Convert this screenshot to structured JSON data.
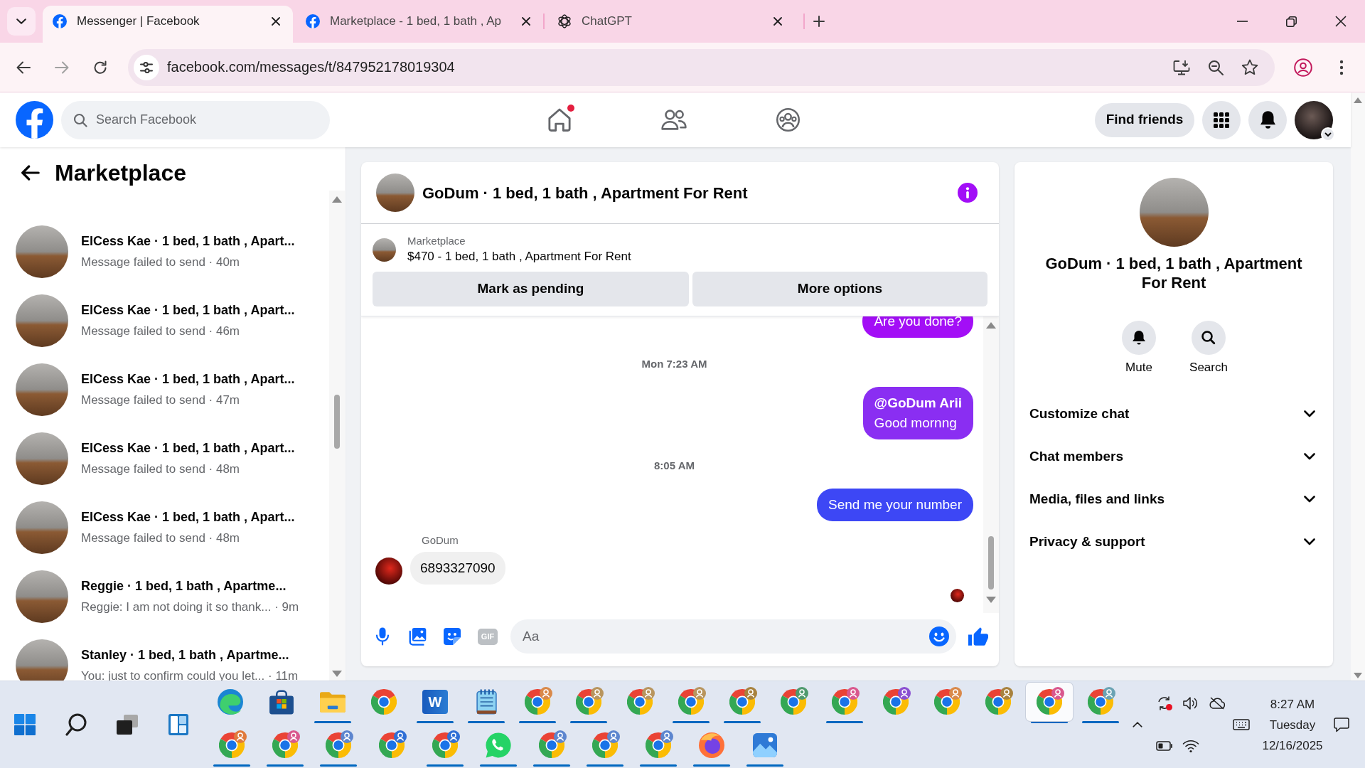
{
  "browser": {
    "tabs": [
      {
        "kind": "facebook",
        "title": "Messenger | Facebook",
        "selected": true
      },
      {
        "kind": "facebook",
        "title": "Marketplace - 1 bed, 1 bath , Ap",
        "selected": false
      },
      {
        "kind": "chatgpt",
        "title": "ChatGPT",
        "selected": false
      }
    ],
    "url": "facebook.com/messages/t/847952178019304"
  },
  "header": {
    "search": {
      "placeholder": "Search Facebook"
    },
    "nav": [
      {
        "kind": "home",
        "selected": false,
        "notification_dot": true
      },
      {
        "kind": "friends",
        "selected": false,
        "notification_dot": false
      },
      {
        "kind": "groups",
        "selected": false,
        "notification_dot": false
      }
    ],
    "find_friends": "Find friends"
  },
  "sidebar": {
    "title": "Marketplace",
    "conversations": [
      {
        "title": "ElCess Kae · 1 bed, 1 bath , Apart...",
        "subtitle": "Message failed to send · 40m"
      },
      {
        "title": "ElCess Kae · 1 bed, 1 bath , Apart...",
        "subtitle": "Message failed to send · 46m"
      },
      {
        "title": "ElCess Kae · 1 bed, 1 bath , Apart...",
        "subtitle": "Message failed to send · 47m"
      },
      {
        "title": "ElCess Kae · 1 bed, 1 bath , Apart...",
        "subtitle": "Message failed to send · 48m"
      },
      {
        "title": "ElCess Kae · 1 bed, 1 bath , Apart...",
        "subtitle": "Message failed to send · 48m"
      },
      {
        "title": "Reggie · 1 bed, 1 bath , Apartme...",
        "subtitle": "Reggie: I am not doing it so thank... · 9m"
      },
      {
        "title": "Stanley · 1 bed, 1 bath , Apartme...",
        "subtitle": "You: just to confirm could you let... · 11m"
      }
    ]
  },
  "chat": {
    "title": "GoDum · 1 bed, 1 bath , Apartment For Rent",
    "listing": {
      "source": "Marketplace",
      "text": "$470 - 1 bed, 1 bath , Apartment For Rent"
    },
    "actions": [
      "Mark as pending",
      "More options"
    ],
    "messages": [
      {
        "kind": "sent",
        "text": "Are you done?",
        "color": "#a30ef6"
      },
      {
        "kind": "timestamp",
        "text": "Mon 7:23 AM"
      },
      {
        "kind": "sent",
        "text": "**@GoDum Arii**\nGood mornng",
        "color": "#8a2ef2"
      },
      {
        "kind": "timestamp",
        "text": "8:05 AM"
      },
      {
        "kind": "sent",
        "text": "Send me your number",
        "color": "#3d47f5"
      },
      {
        "kind": "received",
        "sender": "GoDum",
        "text": "6893327090"
      }
    ],
    "seen": true,
    "composer": {
      "gif": "GIF",
      "placeholder": "Aa"
    }
  },
  "details": {
    "title": "GoDum · 1 bed, 1 bath , Apartment For Rent",
    "actions": [
      {
        "kind": "mute",
        "label": "Mute"
      },
      {
        "kind": "search",
        "label": "Search"
      }
    ],
    "sections": [
      {
        "label": "Customize chat",
        "expanded": false
      },
      {
        "label": "Chat members",
        "expanded": false
      },
      {
        "label": "Media, files and links",
        "expanded": false
      },
      {
        "label": "Privacy & support",
        "expanded": false
      }
    ]
  },
  "taskbar": {
    "rows": [
      [
        {
          "kind": "edge",
          "running": false,
          "selected": false
        },
        {
          "kind": "store",
          "running": false,
          "selected": false
        },
        {
          "kind": "folder",
          "running": true,
          "selected": false
        },
        {
          "kind": "browser",
          "running": false,
          "selected": false
        },
        {
          "kind": "word",
          "label": "W",
          "running": true,
          "selected": false
        },
        {
          "kind": "notepad",
          "running": true,
          "selected": false
        },
        {
          "kind": "browser",
          "color": "#d9894a",
          "running": true,
          "selected": false
        },
        {
          "kind": "browser",
          "color": "#b8955e",
          "running": true,
          "selected": false
        },
        {
          "kind": "browser",
          "color": "#b8955e",
          "running": false,
          "selected": false
        },
        {
          "kind": "browser",
          "color": "#b8955e",
          "running": true,
          "selected": false
        },
        {
          "kind": "browser",
          "color": "#a8823e",
          "running": true,
          "selected": false
        },
        {
          "kind": "browser",
          "color": "#4f9a6e",
          "running": false,
          "selected": false
        },
        {
          "kind": "browser",
          "color": "#d9588e",
          "running": true,
          "selected": false
        },
        {
          "kind": "browser",
          "color": "#8a4fd1",
          "running": false,
          "selected": false
        },
        {
          "kind": "browser",
          "color": "#d9894a",
          "running": false,
          "selected": false
        },
        {
          "kind": "browser",
          "color": "#a8823e",
          "running": false,
          "selected": false
        },
        {
          "kind": "browser",
          "color": "#d9588e",
          "running": true,
          "selected": true
        },
        {
          "kind": "browser",
          "color": "#6ba3b3",
          "running": true,
          "selected": false
        }
      ],
      [
        {
          "kind": "browser",
          "color": "#e07a3c",
          "running": true,
          "selected": false
        },
        {
          "kind": "browser",
          "color": "#d9588e",
          "running": true,
          "selected": false
        },
        {
          "kind": "browser",
          "color": "#5d86cf",
          "running": true,
          "selected": false
        },
        {
          "kind": "browser",
          "color": "#2f6fd6",
          "running": false,
          "selected": false
        },
        {
          "kind": "browser",
          "color": "#2f6fd6",
          "running": true,
          "selected": false
        },
        {
          "kind": "whatsapp",
          "running": true,
          "selected": false
        },
        {
          "kind": "browser",
          "color": "#5d86cf",
          "running": true,
          "selected": false
        },
        {
          "kind": "browser",
          "color": "#5d86cf",
          "running": true,
          "selected": false
        },
        {
          "kind": "browser",
          "color": "#5d86cf",
          "running": true,
          "selected": false
        },
        {
          "kind": "firefox",
          "running": true,
          "selected": false
        },
        {
          "kind": "photos",
          "running": true,
          "selected": false
        }
      ]
    ],
    "clock": {
      "time": "8:27 AM",
      "day": "Tuesday",
      "date": "12/16/2025"
    }
  }
}
